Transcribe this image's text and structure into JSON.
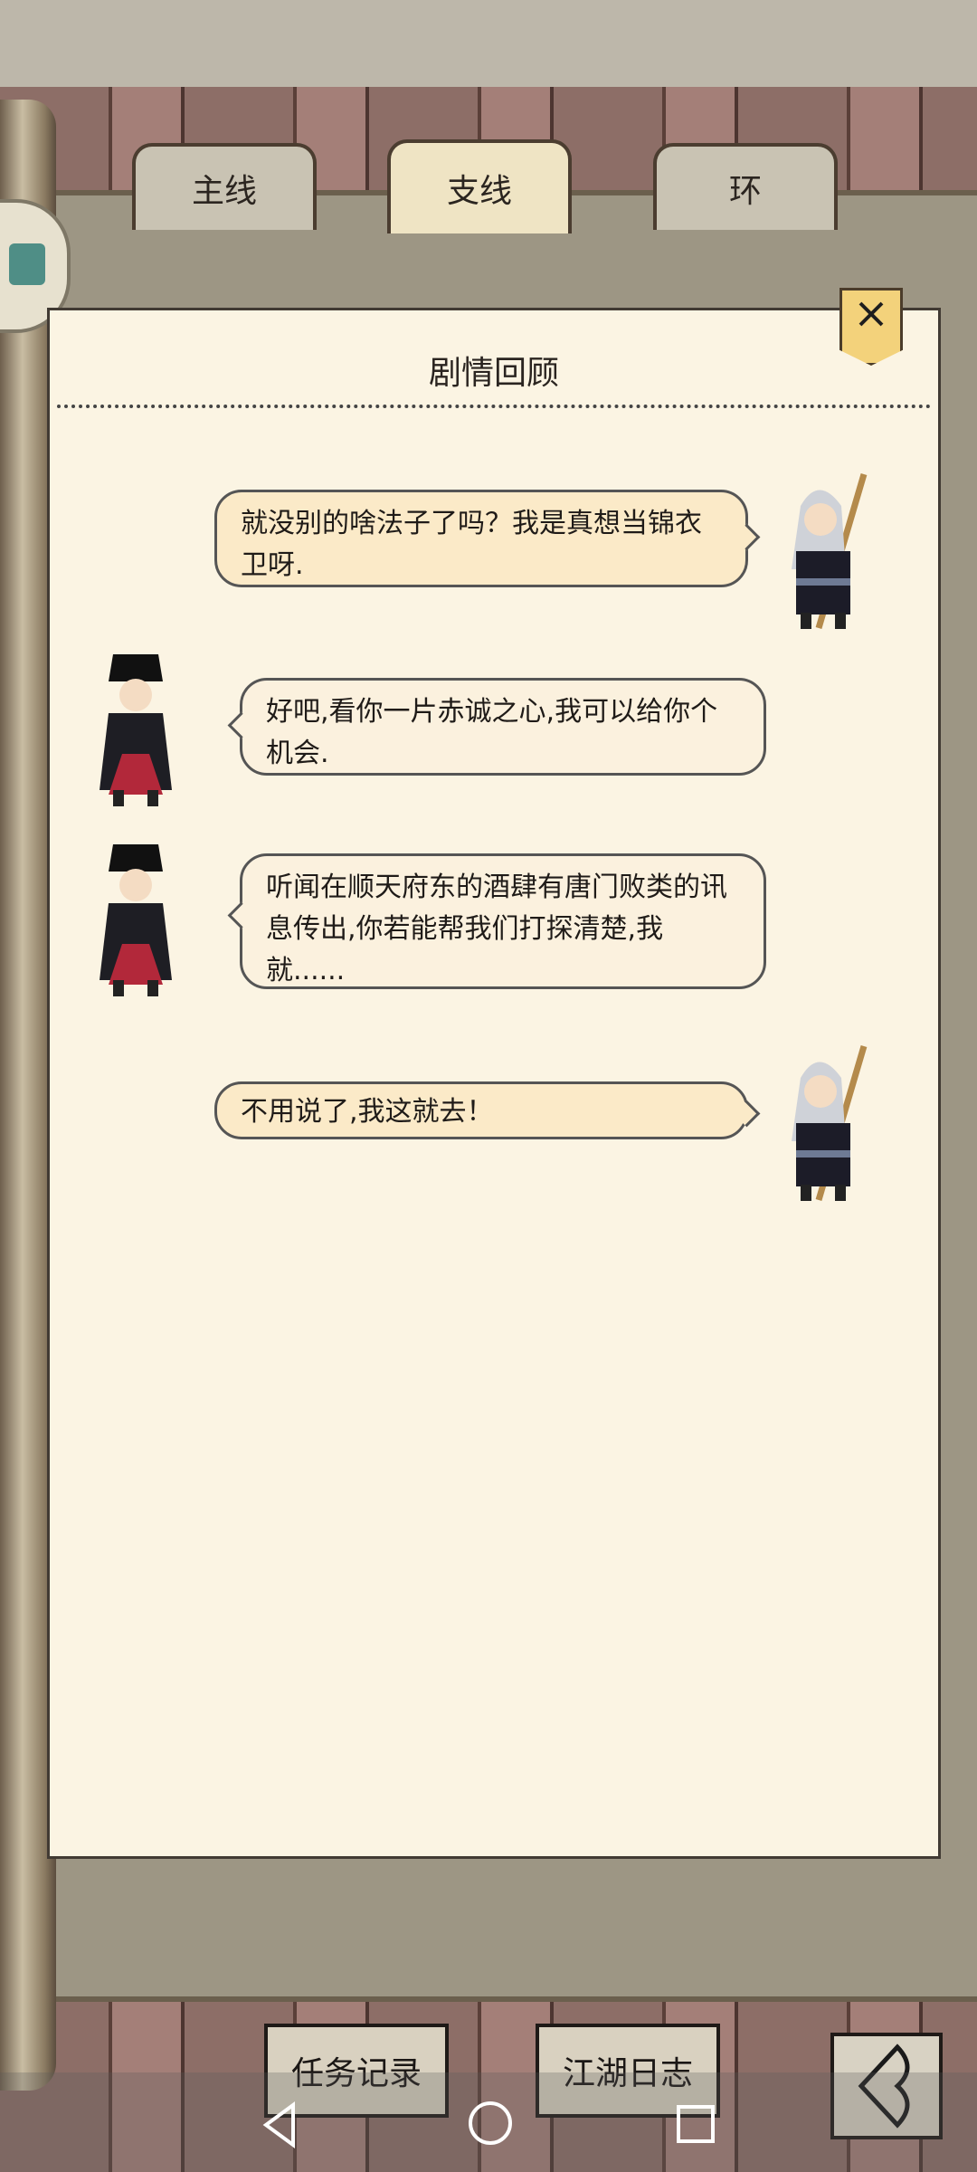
{
  "tabs": [
    {
      "label": "主线"
    },
    {
      "label": "支线"
    },
    {
      "label": "环"
    }
  ],
  "panel": {
    "title": "剧情回顾"
  },
  "dialogue": [
    {
      "side": "right",
      "speaker": "white-hair-character",
      "text": "就没别的啥法子了吗？我是真想当锦衣卫呀."
    },
    {
      "side": "left",
      "speaker": "black-hat-character",
      "text": "好吧,看你一片赤诚之心,我可以给你个机会."
    },
    {
      "side": "left",
      "speaker": "black-hat-character",
      "text": "听闻在顺天府东的酒肆有唐门败类的讯息传出,你若能帮我们打探清楚,我就......"
    },
    {
      "side": "right",
      "speaker": "white-hair-character",
      "text": "不用说了,我这就去！"
    }
  ],
  "bottom": {
    "task_log": "任务记录",
    "jianghu_log": "江湖日志"
  },
  "colors": {
    "panel_bg": "#fbf4e3",
    "bubble_right": "#fbeac8",
    "close_button": "#f3d27b"
  }
}
